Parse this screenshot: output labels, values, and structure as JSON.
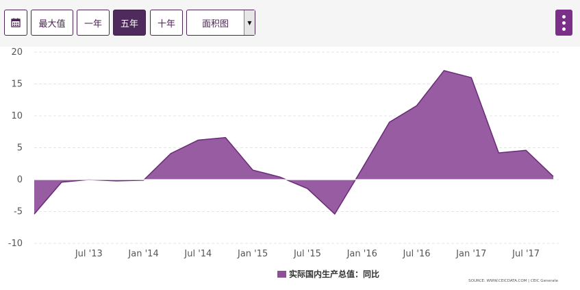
{
  "toolbar": {
    "calendar_icon": "calendar-icon",
    "buttons": [
      {
        "label": "最大值",
        "active": false
      },
      {
        "label": "一年",
        "active": false
      },
      {
        "label": "五年",
        "active": true
      },
      {
        "label": "十年",
        "active": false
      }
    ],
    "chart_type_select": {
      "value": "面积图"
    },
    "menu_icon": "more-vertical-icon"
  },
  "colors": {
    "accent": "#7a2f88",
    "area_fill": "#8e4e99",
    "area_line": "#6a2a78",
    "active_button": "#4f2a5c"
  },
  "chart_data": {
    "type": "area",
    "x_ticks": [
      "Jul '13",
      "Jan '14",
      "Jul '14",
      "Jan '15",
      "Jul '15",
      "Jan '16",
      "Jul '16",
      "Jan '17",
      "Jul '17"
    ],
    "y_ticks": [
      "20",
      "15",
      "10",
      "5",
      "0",
      "-5",
      "-10"
    ],
    "ylim": [
      -10,
      20
    ],
    "grid": true,
    "series": [
      {
        "name": "实际国内生产总值：同比",
        "x": [
          "2013-01",
          "2013-04",
          "2013-07",
          "2013-10",
          "2014-01",
          "2014-04",
          "2014-07",
          "2014-10",
          "2015-01",
          "2015-04",
          "2015-07",
          "2015-10",
          "2016-01",
          "2016-04",
          "2016-07",
          "2016-10",
          "2017-01",
          "2017-04",
          "2017-07",
          "2017-10"
        ],
        "values": [
          -5.4,
          -0.4,
          0.0,
          -0.2,
          -0.1,
          4.1,
          6.2,
          6.6,
          1.5,
          0.4,
          -1.4,
          -5.4,
          1.7,
          9.0,
          11.6,
          17.1,
          16.0,
          4.2,
          4.6,
          0.5
        ]
      }
    ],
    "legend": "bottom-center",
    "source": "SOURCE: WWW.CEICDATA.COM | CEIC Generate"
  }
}
